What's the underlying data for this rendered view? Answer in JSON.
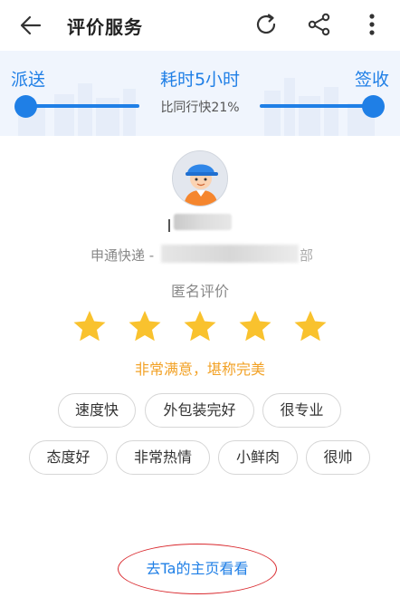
{
  "header": {
    "title": "评价服务"
  },
  "timeline": {
    "left_label": "派送",
    "center_label": "耗时5小时",
    "right_label": "签收",
    "compare_text": "比同行快21%"
  },
  "courier": {
    "company_prefix": "申通快递 - ",
    "company_suffix": "部"
  },
  "review": {
    "anonymous_label": "匿名评价",
    "rating": 5,
    "rating_max": 5,
    "verdict": "非常满意，堪称完美"
  },
  "tags": [
    "速度快",
    "外包装完好",
    "很专业",
    "态度好",
    "非常热情",
    "小鲜肉",
    "很帅"
  ],
  "footer": {
    "home_link": "去Ta的主页看看"
  },
  "colors": {
    "accent": "#1f7fe6",
    "star": "#f9c22e",
    "verdict": "#f2a227",
    "link_circle": "#d9282d"
  }
}
